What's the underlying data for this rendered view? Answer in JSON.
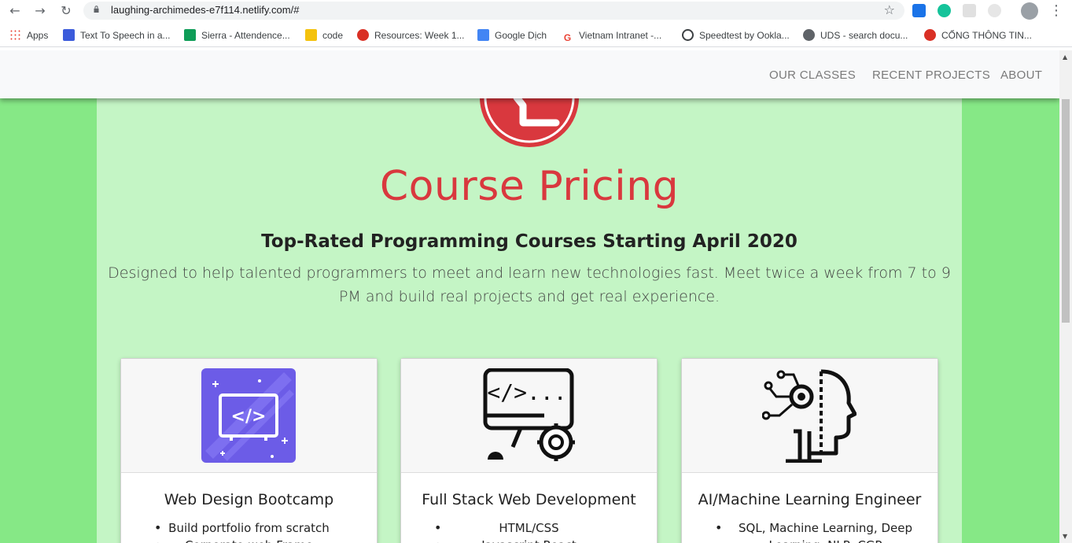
{
  "browser": {
    "url": "laughing-archimedes-e7f114.netlify.com/#",
    "bookmarks": [
      {
        "label": "Apps",
        "color": "#4285f4"
      },
      {
        "label": "Text To Speech in a...",
        "color": "#3b5bdb"
      },
      {
        "label": "Sierra - Attendence...",
        "color": "#0f9d58"
      },
      {
        "label": "code",
        "color": "#f4c20d"
      },
      {
        "label": "Resources: Week 1...",
        "color": "#d93025"
      },
      {
        "label": "Google Dịch",
        "color": "#4285f4"
      },
      {
        "label": "Vietnam Intranet -...",
        "color": "#ea4335"
      },
      {
        "label": "Speedtest by Ookla...",
        "color": "#3c4043"
      },
      {
        "label": "UDS - search docu...",
        "color": "#3c4043"
      },
      {
        "label": "CỔNG THÔNG TIN...",
        "color": "#d93025"
      }
    ]
  },
  "navbar": {
    "links": [
      "OUR CLASSES",
      "RECENT PROJECTS",
      "ABOUT"
    ]
  },
  "hero": {
    "title": "Course Pricing",
    "subtitle": "Top-Rated Programming Courses Starting April 2020",
    "description": "Designed to help talented programmers to meet and learn new technologies fast. Meet twice a week from 7 to 9 PM and build real projects and get real experience."
  },
  "cards": [
    {
      "title": "Web Design Bootcamp",
      "icon": "code-window-icon",
      "items": [
        "Build portfolio from scratch",
        "Corporate-web Frame"
      ]
    },
    {
      "title": "Full Stack Web Development",
      "icon": "computer-gear-icon",
      "items": [
        "HTML/CSS",
        "Javascript React"
      ]
    },
    {
      "title": "AI/Machine Learning Engineer",
      "icon": "ai-head-icon",
      "items": [
        "SQL, Machine Learning, Deep Learning, NLP, CGP"
      ]
    }
  ],
  "colors": {
    "accent": "#d9383e",
    "page_bg": "#86e886",
    "container_bg": "#c4f5c5"
  }
}
